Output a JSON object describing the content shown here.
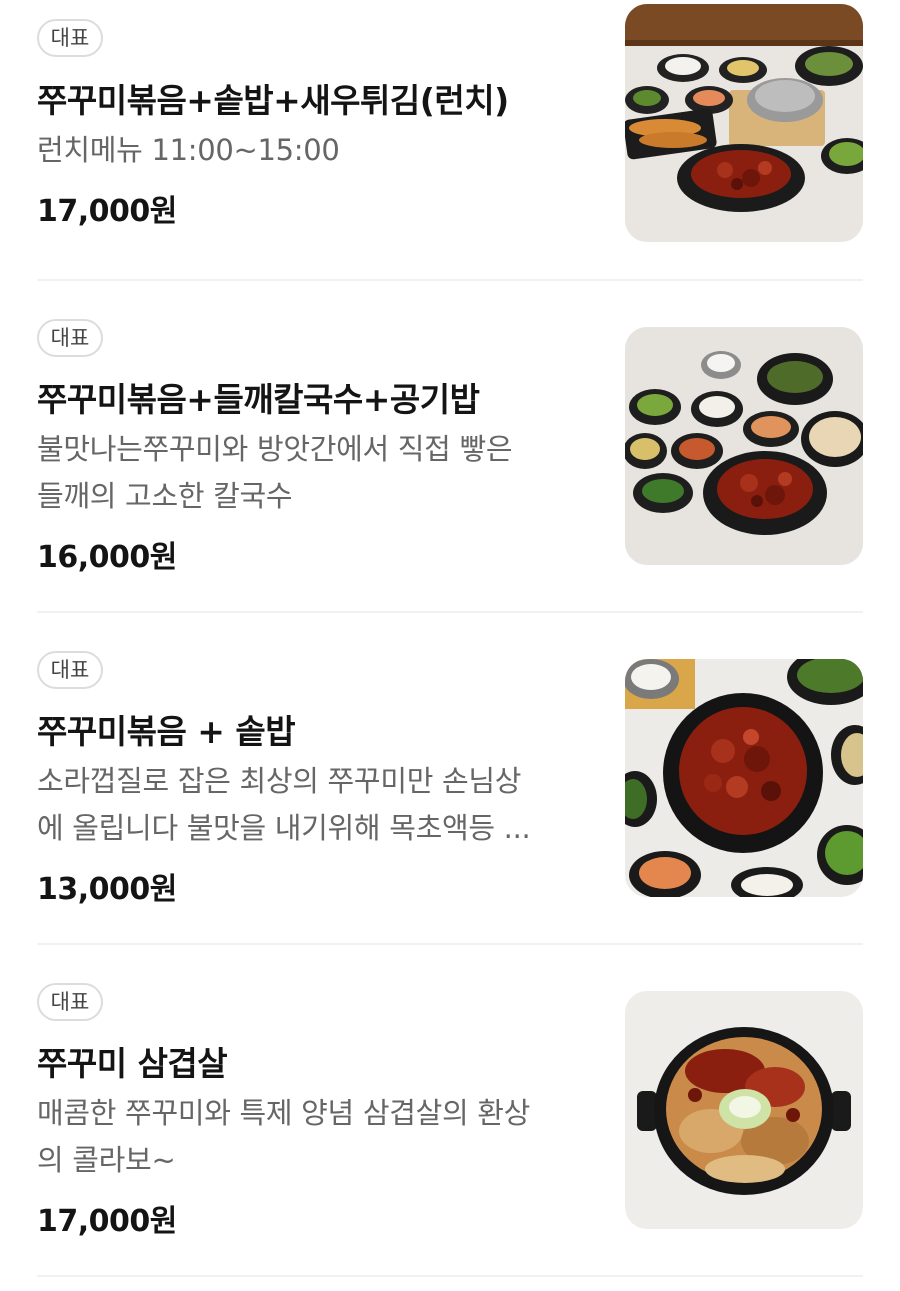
{
  "menu": {
    "items": [
      {
        "badge": "대표",
        "name": "쭈꾸미볶음+솥밥+새우튀김(런치)",
        "description": "런치메뉴 11:00~15:00",
        "price": "17,000원",
        "image_alt": "lunch-set-photo"
      },
      {
        "badge": "대표",
        "name": "쭈꾸미볶음+들깨칼국수+공기밥",
        "description_lines": [
          "불맛나는쭈꾸미와 방앗간에서 직접 빻은",
          "들깨의 고소한 칼국수"
        ],
        "price": "16,000원",
        "image_alt": "noodle-set-photo"
      },
      {
        "badge": "대표",
        "name": "쭈꾸미볶음 + 솥밥",
        "description_lines": [
          "소라껍질로 잡은 최상의 쭈꾸미만 손님상",
          "에 올립니다 불맛을 내기위해 목초액등 ..."
        ],
        "price": "13,000원",
        "image_alt": "stir-fry-set-photo"
      },
      {
        "badge": "대표",
        "name": "쭈꾸미 삼겹살",
        "description_lines": [
          "매콤한 쭈꾸미와 특제 양념 삼겹살의 환상",
          "의 콜라보~"
        ],
        "price": "17,000원",
        "image_alt": "pork-belly-pan-photo"
      }
    ]
  },
  "colors": {
    "badge_border": "#dcdcdc",
    "title": "#141414",
    "description": "#666666",
    "divider": "#f1f1f1",
    "sauce_red": "#8a1f10"
  }
}
